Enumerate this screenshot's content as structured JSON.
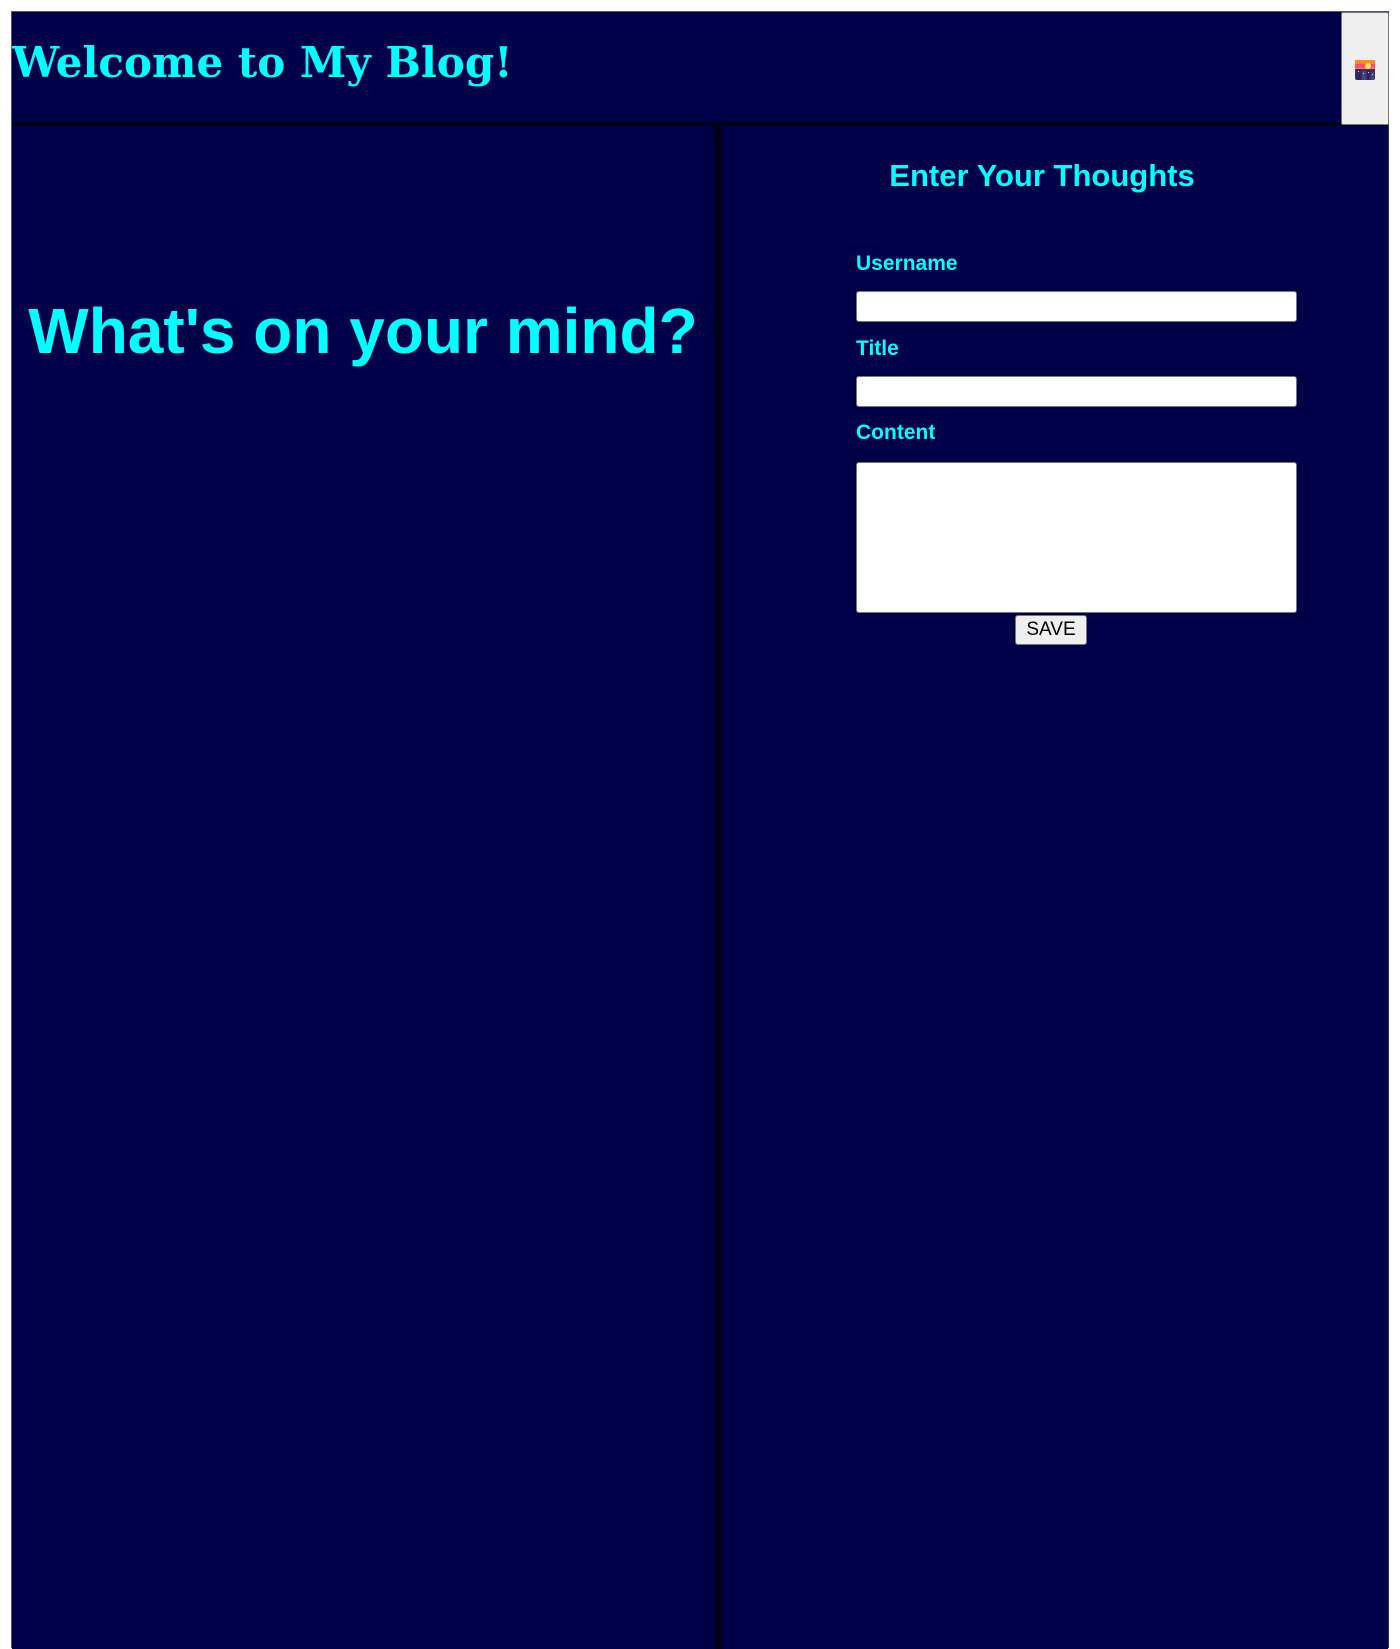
{
  "header": {
    "title": "Welcome to My Blog!",
    "theme_toggle_icon": "night-cityscape-icon"
  },
  "left_panel": {
    "heading": "What's on your mind?"
  },
  "form": {
    "heading": "Enter Your Thoughts",
    "username_label": "Username",
    "username_value": "",
    "title_label": "Title",
    "title_value": "",
    "content_label": "Content",
    "content_value": "",
    "save_label": "SAVE"
  },
  "colors": {
    "background": "#000048",
    "accent_text": "#00ffff",
    "divider": "#000018",
    "input_background": "#ffffff",
    "button_background": "#efefef"
  }
}
